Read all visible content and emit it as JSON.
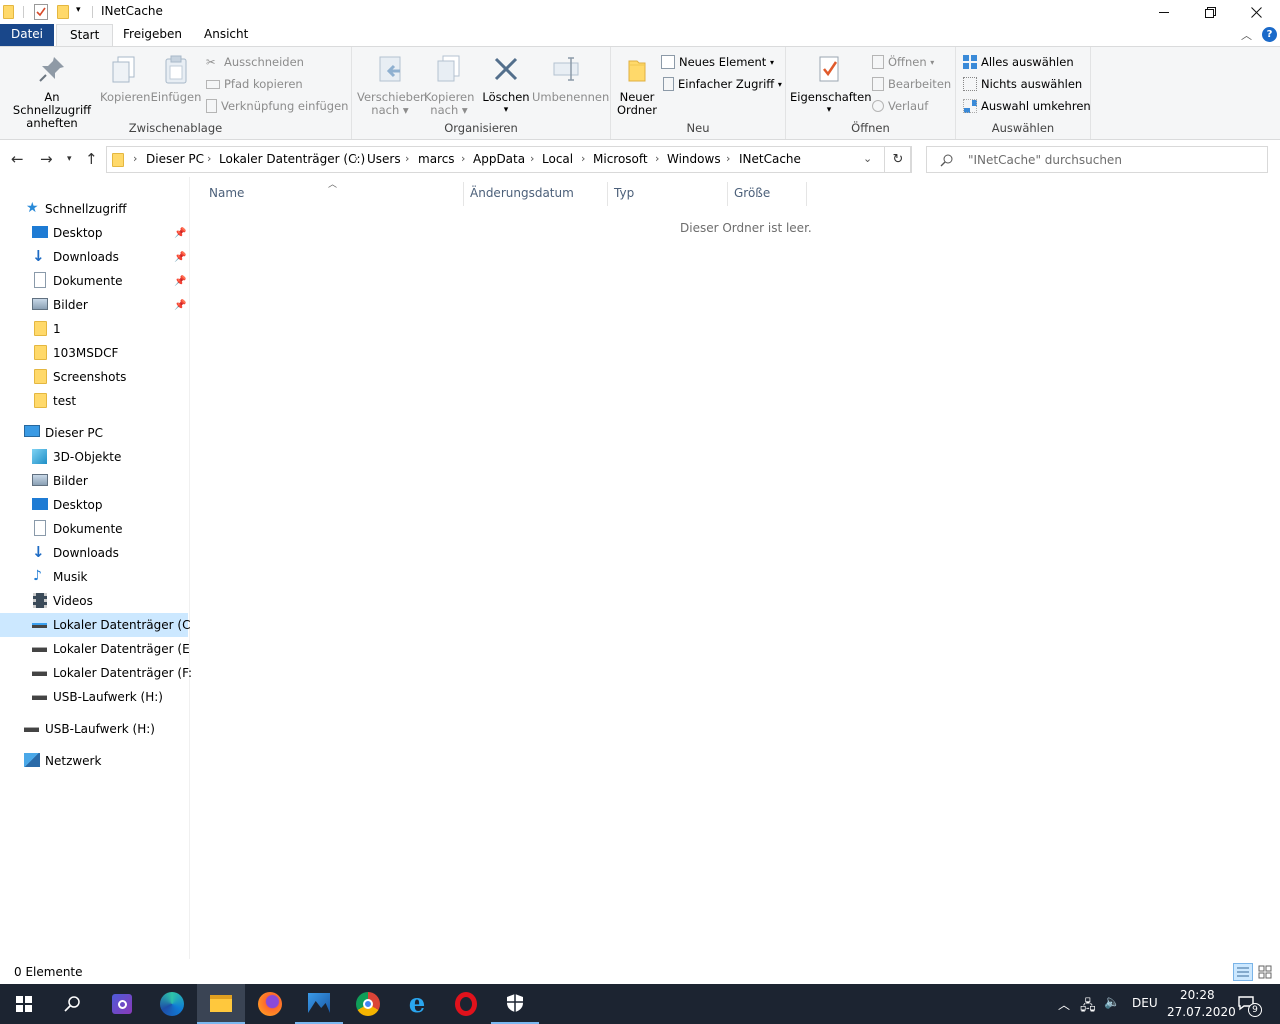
{
  "window": {
    "title": "INetCache"
  },
  "tabs": {
    "datei": "Datei",
    "start": "Start",
    "freigeben": "Freigeben",
    "ansicht": "Ansicht"
  },
  "ribbon": {
    "zwischenablage": {
      "label": "Zwischenablage",
      "pin_l1": "An Schnellzugriff",
      "pin_l2": "anheften",
      "kopieren": "Kopieren",
      "einfuegen": "Einfügen",
      "ausschneiden": "Ausschneiden",
      "pfad": "Pfad kopieren",
      "verknuepfung": "Verknüpfung einfügen"
    },
    "organisieren": {
      "label": "Organisieren",
      "verschieben_l1": "Verschieben",
      "verschieben_l2": "nach",
      "kopieren_l1": "Kopieren",
      "kopieren_l2": "nach",
      "loeschen": "Löschen",
      "umbenennen": "Umbenennen"
    },
    "neu": {
      "label": "Neu",
      "ordner_l1": "Neuer",
      "ordner_l2": "Ordner",
      "element": "Neues Element",
      "zugriff": "Einfacher Zugriff"
    },
    "oeffnen": {
      "label": "Öffnen",
      "eigenschaften": "Eigenschaften",
      "oeffnen": "Öffnen",
      "bearbeiten": "Bearbeiten",
      "verlauf": "Verlauf"
    },
    "auswaehlen": {
      "label": "Auswählen",
      "alle": "Alles auswählen",
      "nichts": "Nichts auswählen",
      "umkehren": "Auswahl umkehren"
    }
  },
  "breadcrumb": [
    "Dieser PC",
    "Lokaler Datenträger (C:)",
    "Users",
    "marcs",
    "AppData",
    "Local",
    "Microsoft",
    "Windows",
    "INetCache"
  ],
  "search": {
    "placeholder": "\"INetCache\" durchsuchen"
  },
  "sidebar": {
    "quick": "Schnellzugriff",
    "quick_items": [
      "Desktop",
      "Downloads",
      "Dokumente",
      "Bilder",
      "1",
      "103MSDCF",
      "Screenshots",
      "test"
    ],
    "pc": "Dieser PC",
    "pc_items": [
      "3D-Objekte",
      "Bilder",
      "Desktop",
      "Dokumente",
      "Downloads",
      "Musik",
      "Videos",
      "Lokaler Datenträger (C:)",
      "Lokaler Datenträger (E:)",
      "Lokaler Datenträger (F:)",
      "USB-Laufwerk (H:)"
    ],
    "usb": "USB-Laufwerk (H:)",
    "network": "Netzwerk"
  },
  "columns": [
    "Name",
    "Änderungsdatum",
    "Typ",
    "Größe"
  ],
  "empty_text": "Dieser Ordner ist leer.",
  "status": {
    "count": "0 Elemente"
  },
  "taskbar": {
    "lang": "DEU",
    "time": "20:28",
    "date": "27.07.2020",
    "notifications": "9"
  },
  "colors": {
    "datei_tab": "#19478a",
    "selection": "#cce8ff",
    "taskbar": "#1c2431",
    "folder": "#ffd96a"
  }
}
